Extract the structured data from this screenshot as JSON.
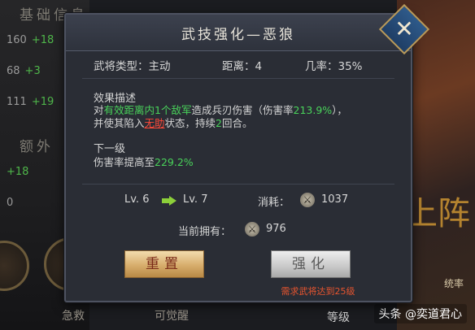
{
  "background": {
    "section_titles": [
      "基础信息",
      "额外"
    ],
    "stats": [
      {
        "value": "160",
        "bonus": "+18"
      },
      {
        "value": "68",
        "bonus": "+3"
      },
      {
        "value": "111",
        "bonus": "+19"
      }
    ],
    "extra_stats": [
      "+18",
      "0"
    ],
    "right_text": "上阵",
    "right_badge": "统率",
    "bottom_labels": [
      "急救",
      "可觉醒",
      "等级"
    ]
  },
  "watermark": "头条 @奕道君心",
  "dialog": {
    "title": "武技强化—恶狼",
    "close_icon": "close-icon",
    "type_label": "武将类型：主动",
    "range_label": "距离：4",
    "chance_label": "几率：35%",
    "effect_heading": "效果描述",
    "effect_line1": {
      "p1": "对",
      "h1": "有效距离内1个敌军",
      "p2": "造成兵刃伤害（伤害率",
      "h2": "213.9%",
      "p3": "），"
    },
    "effect_line2": {
      "p1": "并使其陷入",
      "h1": "无助",
      "p2": "状态，持续",
      "h2": "2",
      "p3": "回合。"
    },
    "next_heading": "下一级",
    "next_line": {
      "p1": "伤害率提高至",
      "h1": "229.2%"
    },
    "level_from": "Lv. 6",
    "level_to": "Lv. 7",
    "cost_label": "消耗：",
    "cost_value": "1037",
    "owned_label": "当前拥有：",
    "owned_value": "976",
    "reset_button": "重置",
    "upgrade_button": "强化",
    "requirement": "需求武将达到25级"
  }
}
